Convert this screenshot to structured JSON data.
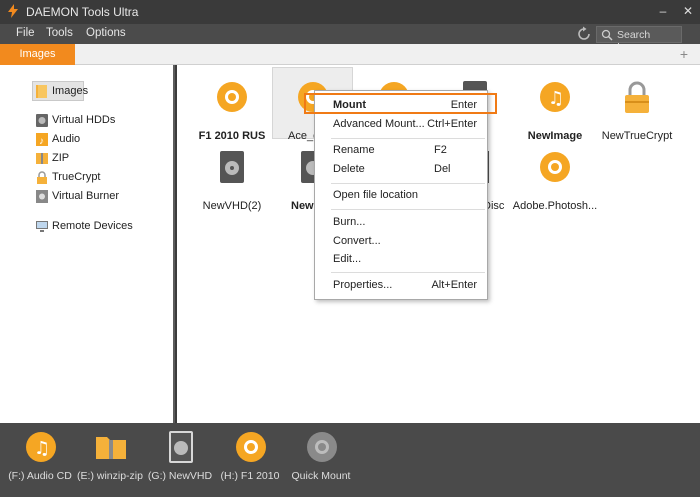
{
  "window": {
    "title": "DAEMON Tools Ultra",
    "minimize": "–",
    "close": "✕"
  },
  "menu": {
    "items": [
      "File",
      "Tools",
      "Options"
    ],
    "search_placeholder": "Search Images"
  },
  "tabs": {
    "active": "Images",
    "add": "+"
  },
  "sidebar": {
    "selected": "Images",
    "items": [
      "Virtual HDDs",
      "Audio",
      "ZIP",
      "TrueCrypt",
      "Virtual Burner"
    ],
    "remote": "Remote Devices"
  },
  "images": [
    {
      "name": "F1 2010 RUS",
      "bold": true
    },
    {
      "name": "Ace_of",
      "bold": false
    },
    {
      "name": "NewImage",
      "bold": true
    },
    {
      "name": "NewTrueCrypt",
      "bold": false
    },
    {
      "name": "NewVHD(2)",
      "bold": false
    },
    {
      "name": "New",
      "bold": true
    },
    {
      "name": "Disc",
      "bold": false
    },
    {
      "name": "Adobe.Photosh...",
      "bold": false
    }
  ],
  "context_menu": {
    "mount": {
      "label": "Mount",
      "key": "Enter"
    },
    "advanced": {
      "label": "Advanced Mount...",
      "key": "Ctrl+Enter"
    },
    "rename": {
      "label": "Rename",
      "key": "F2"
    },
    "delete": {
      "label": "Delete",
      "key": "Del"
    },
    "open_location": {
      "label": "Open file location"
    },
    "burn": {
      "label": "Burn..."
    },
    "convert": {
      "label": "Convert..."
    },
    "edit": {
      "label": "Edit..."
    },
    "properties": {
      "label": "Properties...",
      "key": "Alt+Enter"
    }
  },
  "dock": {
    "items": [
      "(F:) Audio CD",
      "(E:) winzip-zip",
      "(G:) NewVHD",
      "(H:) F1 2010",
      "Quick Mount"
    ]
  },
  "colors": {
    "accent": "#f28a1e",
    "disc": "#f5a623",
    "dark": "#3a3a3a"
  }
}
